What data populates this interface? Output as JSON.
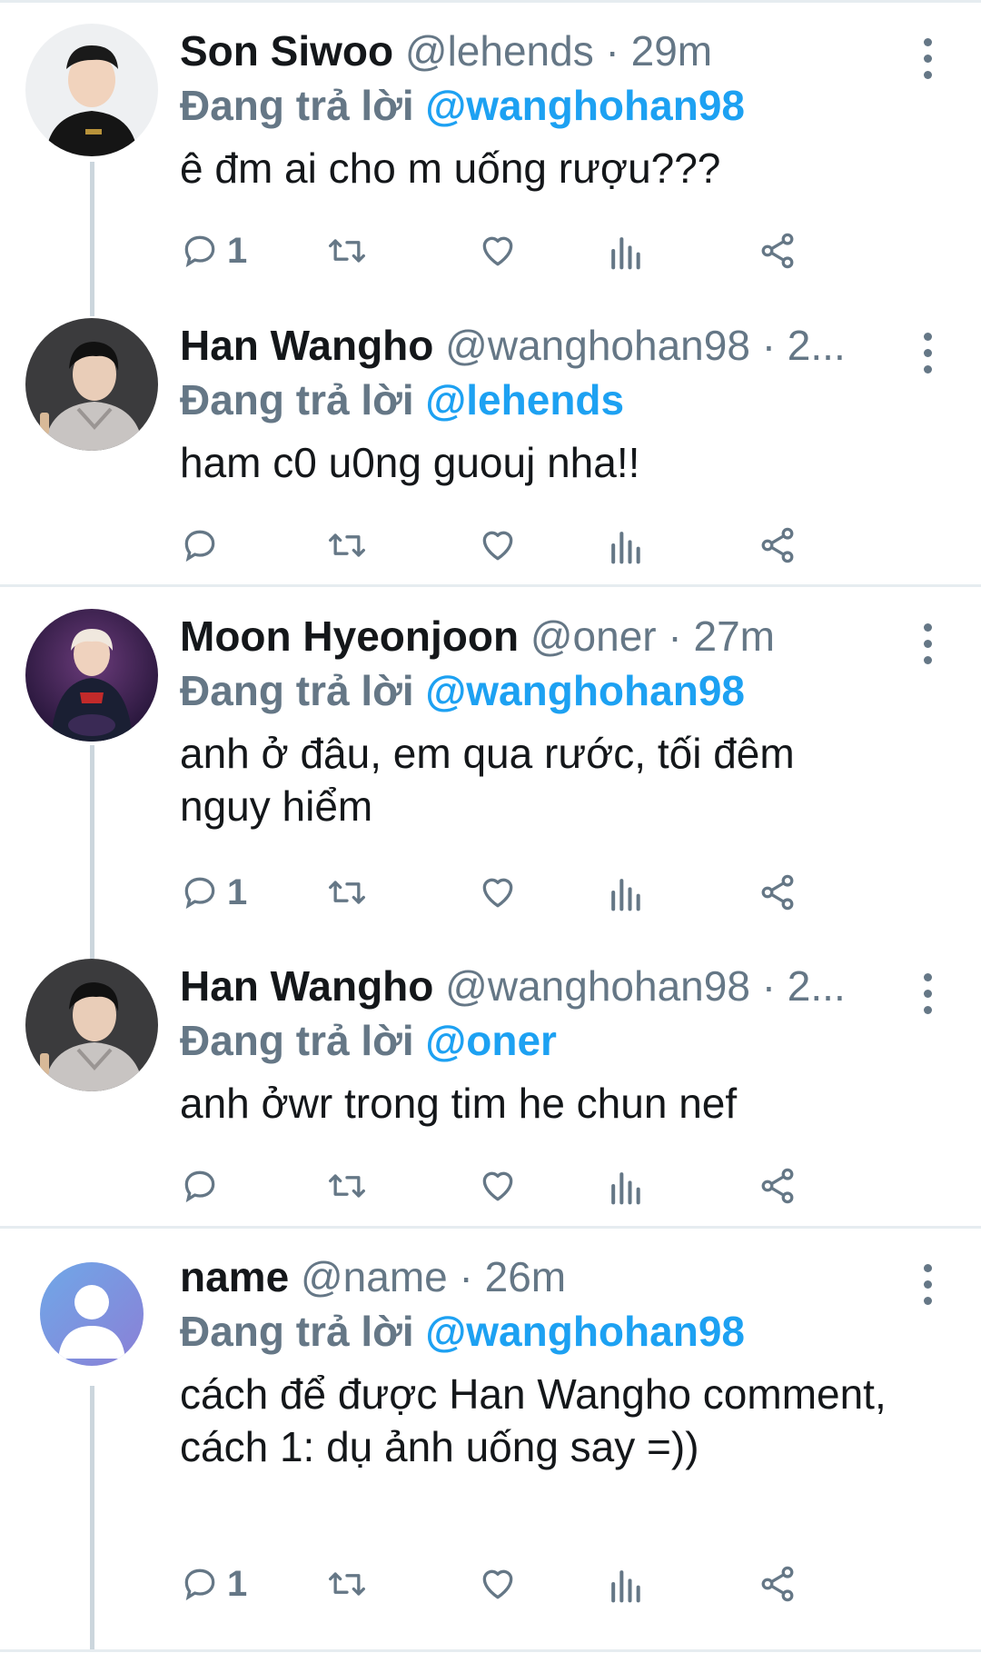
{
  "colors": {
    "accent": "#1da1f2",
    "secondary_text": "#657786",
    "primary_text": "#14171a",
    "thread_line": "#ccd6dd"
  },
  "reply_prefix": "Đang trả lời",
  "tweets": [
    {
      "name": "Son Siwoo",
      "handle": "@lehends",
      "separator": "·",
      "time": "29m",
      "reply_to": "@wanghohan98",
      "text": "ê đm ai cho m uống rượu???",
      "reply_count": "1",
      "avatar_icon": "user-photo-black-hoodie"
    },
    {
      "name": "Han Wangho",
      "handle": "@wanghohan98",
      "separator": "·",
      "time": "2...",
      "reply_to": "@lehends",
      "text": "ham c0 u0ng guouj nha!!",
      "reply_count": "",
      "avatar_icon": "user-photo-grey-hoodie"
    },
    {
      "name": "Moon Hyeonjoon",
      "handle": "@oner",
      "separator": "·",
      "time": "27m",
      "reply_to": "@wanghohan98",
      "text": "anh ở đâu, em qua rước, tối đêm nguy hiểm",
      "reply_count": "1",
      "avatar_icon": "user-photo-team-jersey"
    },
    {
      "name": "Han Wangho",
      "handle": "@wanghohan98",
      "separator": "·",
      "time": "2...",
      "reply_to": "@oner",
      "text": "anh ởwr trong tim he chun nef",
      "reply_count": "",
      "avatar_icon": "user-photo-grey-hoodie"
    },
    {
      "name": "name",
      "handle": "@name",
      "separator": "·",
      "time": "26m",
      "reply_to": "@wanghohan98",
      "text": "cách để được Han Wangho comment, cách 1: dụ ảnh uống say =))",
      "reply_count": "1",
      "avatar_icon": "default-user-icon"
    }
  ]
}
